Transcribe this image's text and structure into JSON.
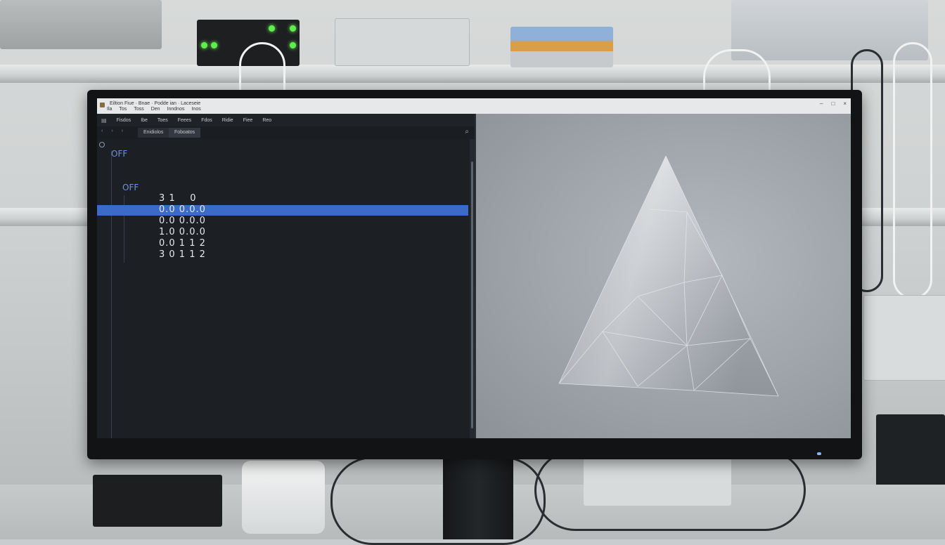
{
  "window": {
    "title": "Eiltion Fiue · Bnae · Podde ian · Laceseie",
    "menu": [
      "Ila",
      "Tos",
      "Toss",
      "Den",
      "Inndnos",
      "Inos"
    ],
    "controls": [
      "–",
      "□",
      "×"
    ]
  },
  "toolbar": {
    "items": [
      "Fisdos",
      "Ibe",
      "Toes",
      "Feees",
      "Fdos",
      "Ridie",
      "Fiee",
      "Reo"
    ]
  },
  "navbar": {
    "tabs": [
      "Enidiolos",
      "Foboatos"
    ]
  },
  "editor": {
    "lines": [
      {
        "text": "OFF",
        "kind": "keyword"
      },
      {
        "text": "OFF",
        "kind": "keyword"
      },
      {
        "text": "3 1    0",
        "kind": "number"
      },
      {
        "text": "0.0 0.0.0",
        "kind": "number",
        "selected": true
      },
      {
        "text": "0.0 0.0.0",
        "kind": "number"
      },
      {
        "text": "1.0 0.0.0",
        "kind": "number"
      },
      {
        "text": "0.0 1 1 2",
        "kind": "number"
      },
      {
        "text": "3 0 1 1 2",
        "kind": "number"
      }
    ]
  },
  "viewport": {
    "object": "cone-mesh",
    "colors": {
      "background": "#9ea3aa",
      "mesh": "#c9ccd1",
      "wire": "#e4e7ea"
    }
  },
  "colors": {
    "selection": "#3a6bc6",
    "keyword": "#6f93d8",
    "editor_bg": "#1c1f24"
  }
}
